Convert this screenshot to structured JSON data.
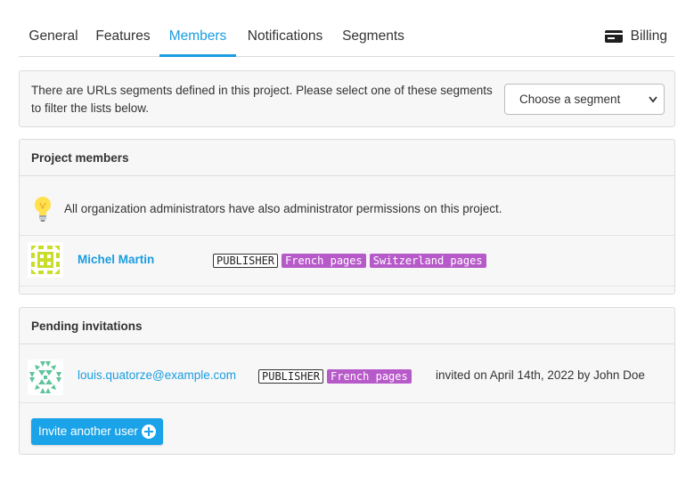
{
  "tabs": {
    "general": "General",
    "features": "Features",
    "members": "Members",
    "notifications": "Notifications",
    "segments": "Segments",
    "billing": "Billing",
    "active": "Members"
  },
  "segments_notice": {
    "text": "There are URLs segments defined in this project. Please select one of these segments to filter the lists below.",
    "select_value": "Choose a segment"
  },
  "project_members": {
    "title": "Project members",
    "info": "All organization administrators have also administrator permissions on this project.",
    "members": [
      {
        "name": "Michel Martin",
        "role": "PUBLISHER",
        "segments": [
          "French pages",
          "Switzerland pages"
        ]
      }
    ]
  },
  "pending_invitations": {
    "title": "Pending invitations",
    "invitations": [
      {
        "email": "louis.quatorze@example.com",
        "role": "PUBLISHER",
        "segments": [
          "French pages"
        ],
        "invited_text": "invited on April 14th, 2022 by John Doe"
      }
    ],
    "invite_button": "Invite another user"
  },
  "colors": {
    "accent": "#1a9de0",
    "segment_badge": "#b75ac9",
    "avatar_member": "#c9dd2c",
    "avatar_pending": "#5ec49a"
  },
  "icons": {
    "billing": "credit-card-icon",
    "info": "lightbulb-icon",
    "invite": "plus-circle-icon",
    "select": "chevron-down-icon"
  }
}
